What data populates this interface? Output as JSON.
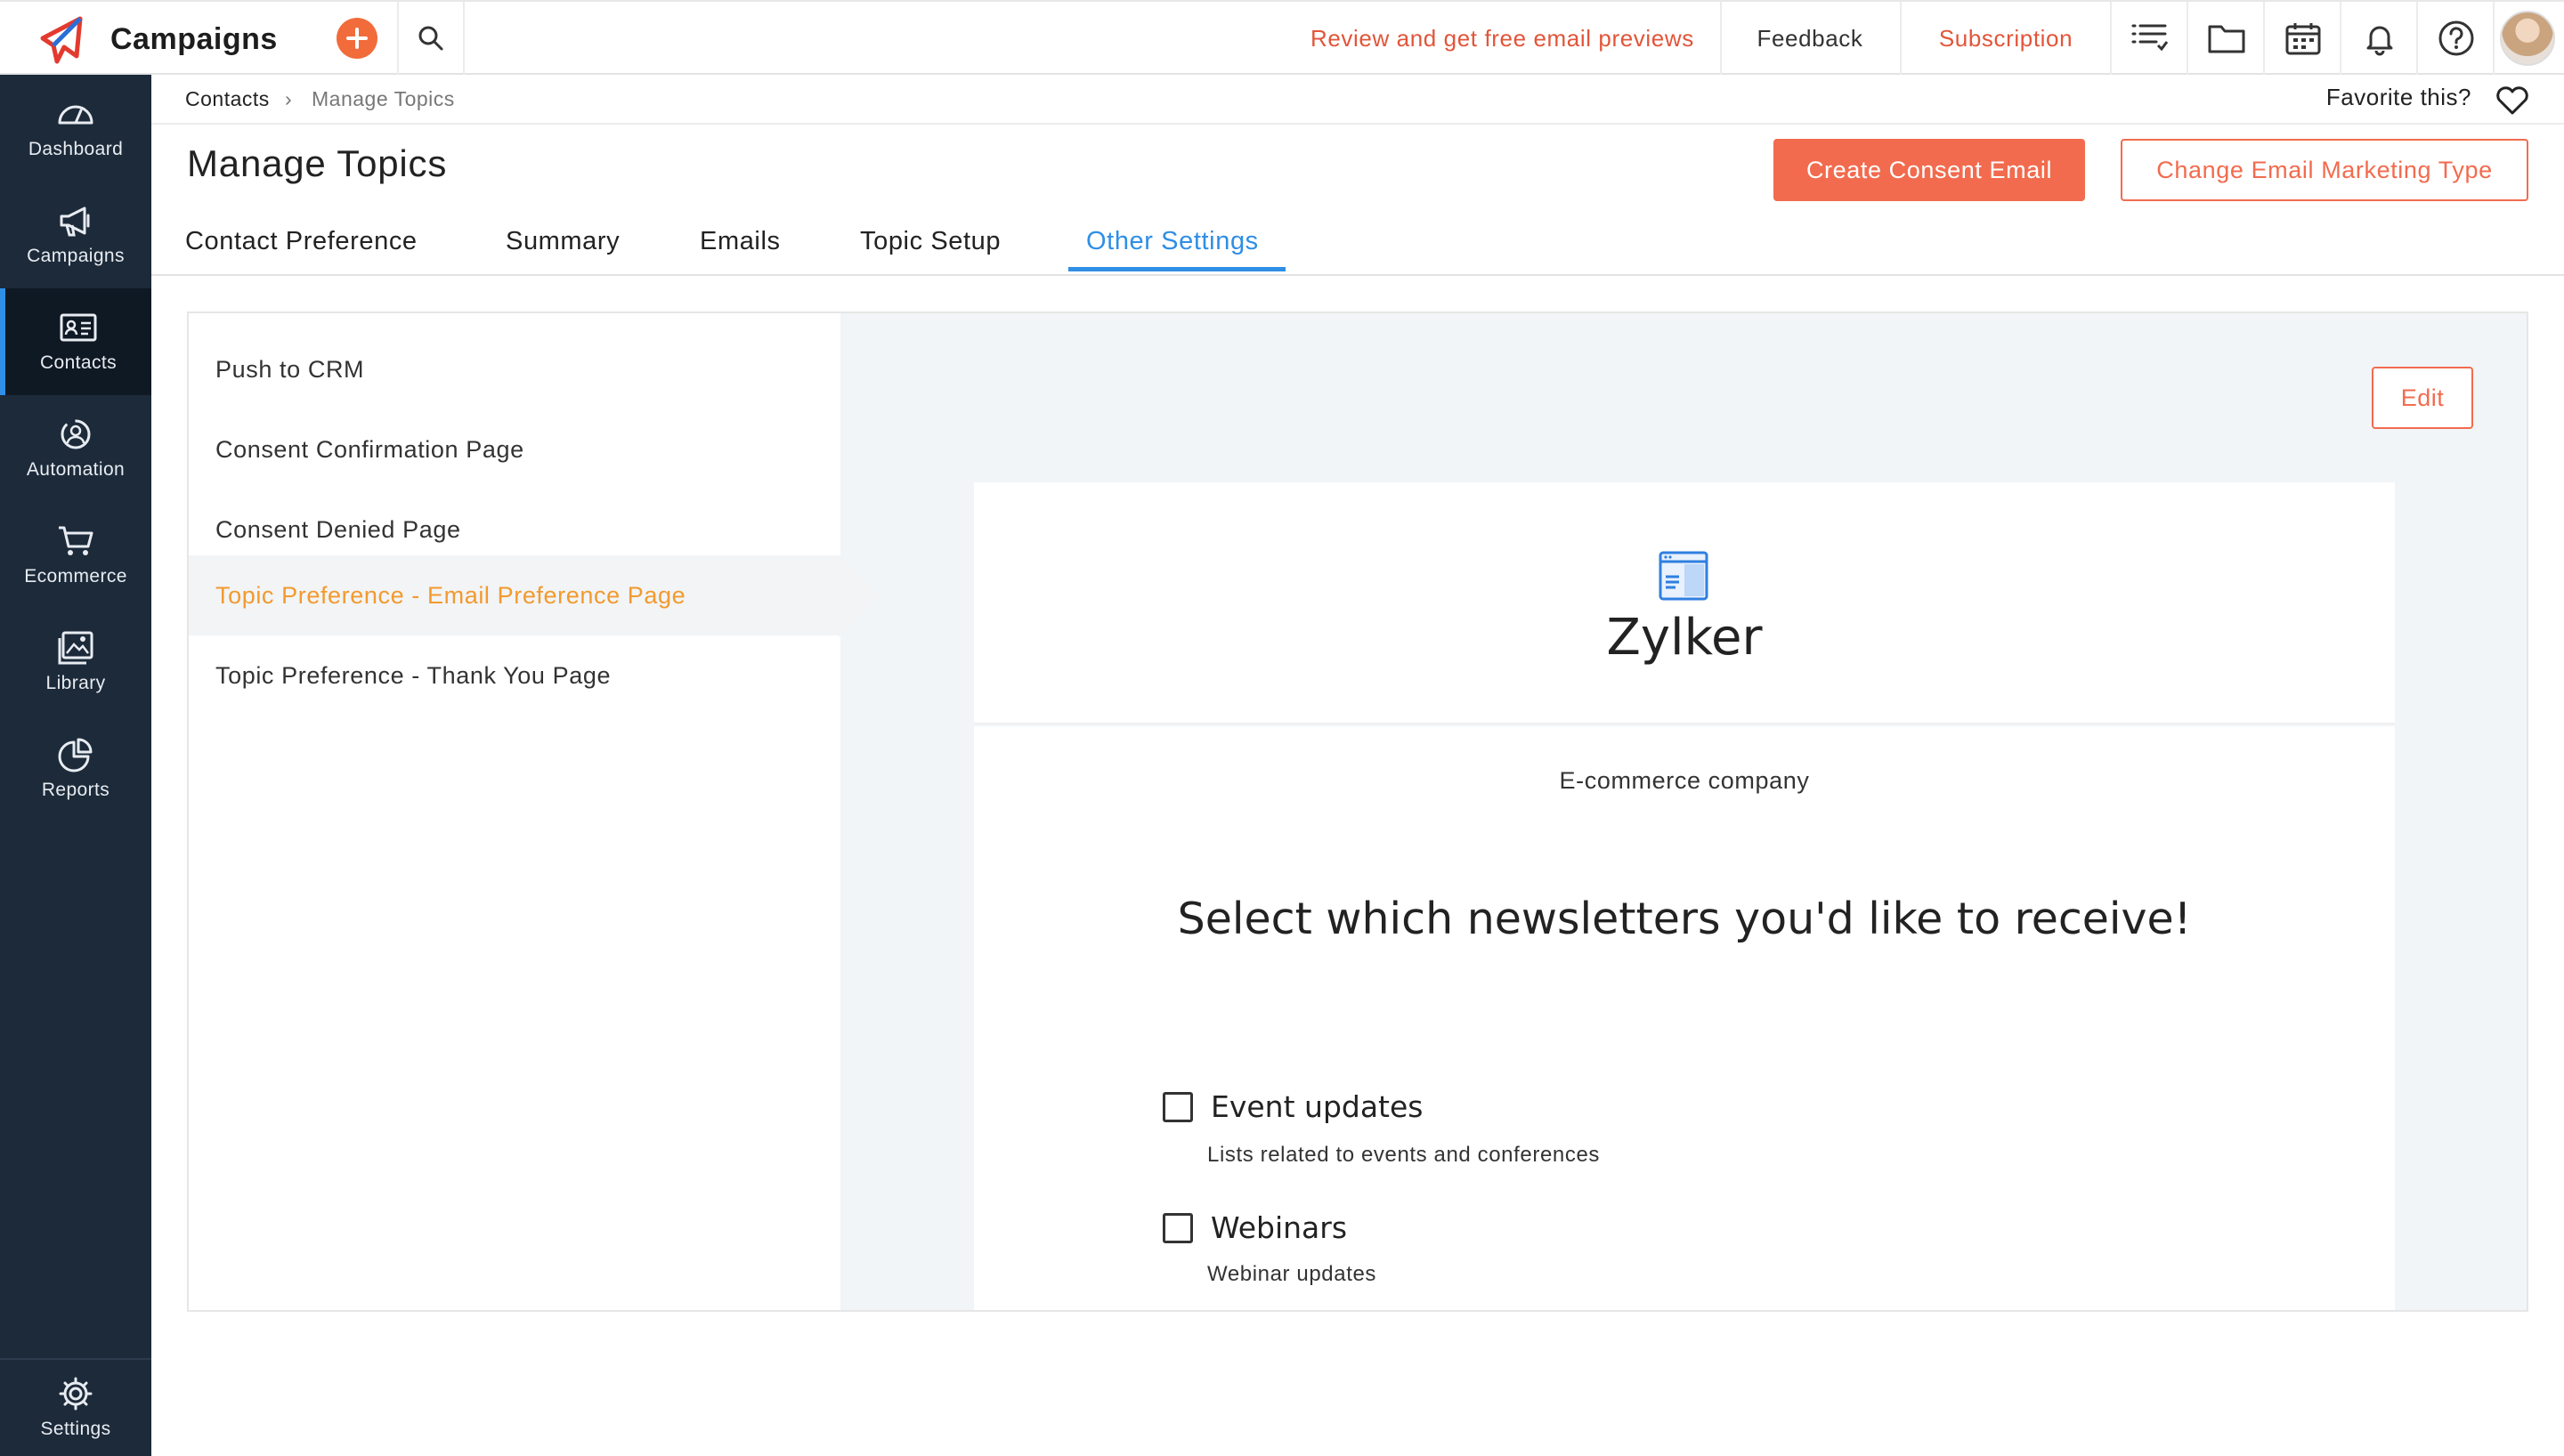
{
  "app": {
    "name": "Campaigns"
  },
  "topbar": {
    "review_link": "Review and get free email previews",
    "feedback": "Feedback",
    "subscription": "Subscription",
    "icons": [
      "list-icon",
      "folder-icon",
      "calendar-icon",
      "bell-icon",
      "help-icon"
    ]
  },
  "sidebar": {
    "items": [
      {
        "label": "Dashboard",
        "icon": "dashboard-icon",
        "active": false
      },
      {
        "label": "Campaigns",
        "icon": "megaphone-icon",
        "active": false
      },
      {
        "label": "Contacts",
        "icon": "contact-card-icon",
        "active": true
      },
      {
        "label": "Automation",
        "icon": "automation-icon",
        "active": false
      },
      {
        "label": "Ecommerce",
        "icon": "cart-icon",
        "active": false
      },
      {
        "label": "Library",
        "icon": "image-library-icon",
        "active": false
      },
      {
        "label": "Reports",
        "icon": "pie-chart-icon",
        "active": false
      }
    ],
    "settings": "Settings"
  },
  "breadcrumb": {
    "parent": "Contacts",
    "separator": "›",
    "current": "Manage Topics"
  },
  "favorite": "Favorite this?",
  "page": {
    "title": "Manage Topics",
    "create_button": "Create Consent Email",
    "change_button": "Change Email Marketing Type"
  },
  "tabs": [
    {
      "label": "Contact Preference",
      "active": false
    },
    {
      "label": "Summary",
      "active": false
    },
    {
      "label": "Emails",
      "active": false
    },
    {
      "label": "Topic Setup",
      "active": false
    },
    {
      "label": "Other Settings",
      "active": true
    }
  ],
  "settings_list": [
    {
      "label": "Push to CRM",
      "active": false
    },
    {
      "label": "Consent Confirmation Page",
      "active": false
    },
    {
      "label": "Consent Denied Page",
      "active": false
    },
    {
      "label": "Topic Preference - Email Preference Page",
      "active": true
    },
    {
      "label": "Topic Preference - Thank You Page",
      "active": false
    }
  ],
  "edit_button": "Edit",
  "preview": {
    "company": "Zylker",
    "tagline": "E-commerce company",
    "headline": "Select which newsletters you'd like to receive!",
    "options": [
      {
        "label": "Event updates",
        "description": "Lists related to events and conferences",
        "checked": false
      },
      {
        "label": "Webinars",
        "description": "Webinar updates",
        "checked": false
      }
    ]
  },
  "colors": {
    "accent": "#f26b4e",
    "tab_active": "#2f8ee5",
    "sidebar": "#1c2a3a",
    "list_active": "#f29a2e"
  }
}
